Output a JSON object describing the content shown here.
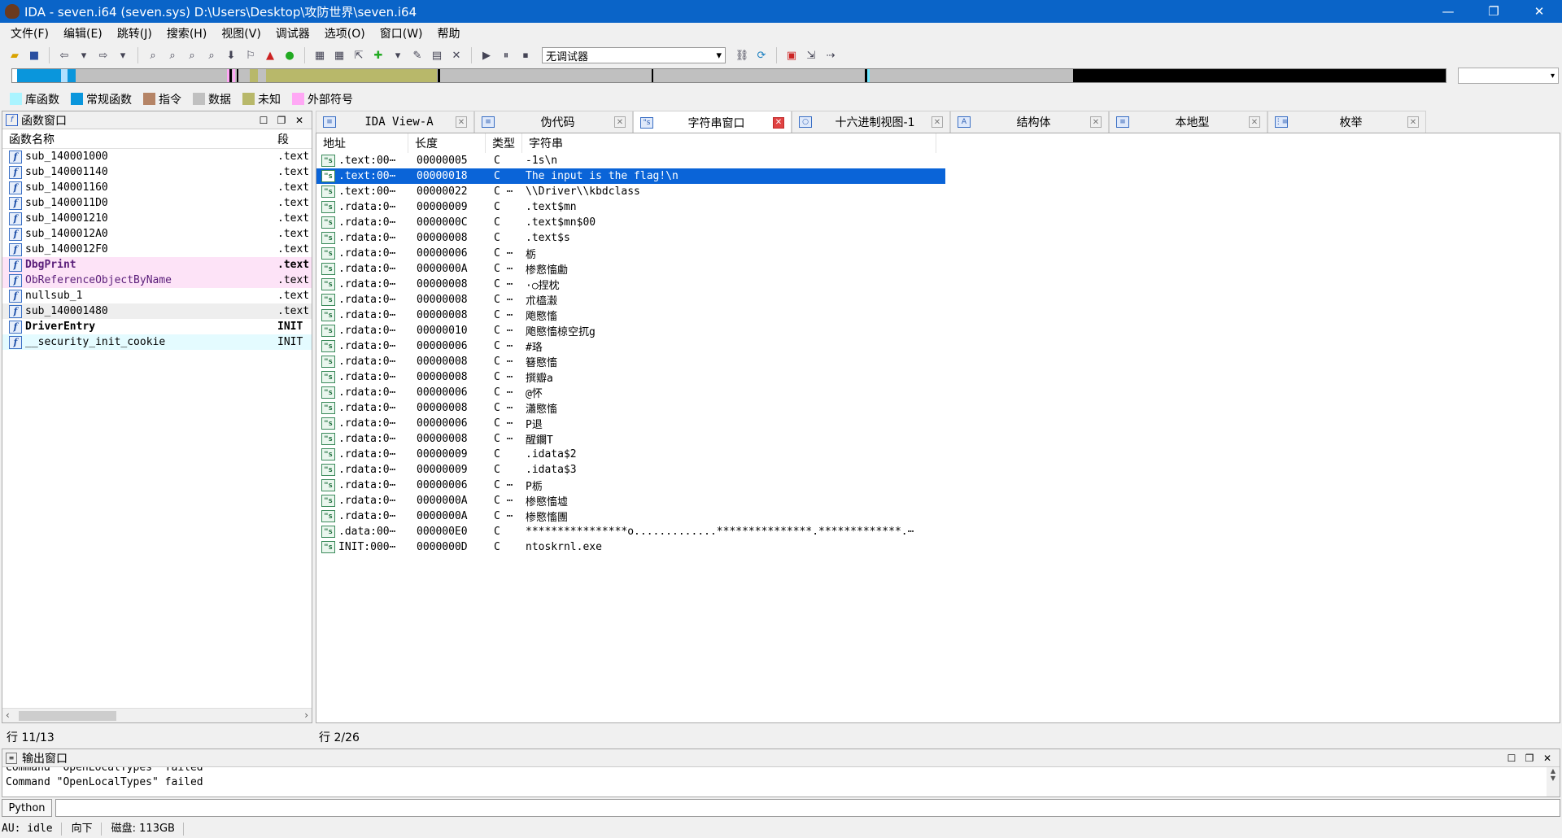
{
  "window": {
    "title": "IDA - seven.i64 (seven.sys) D:\\Users\\Desktop\\攻防世界\\seven.i64",
    "minimize": "—",
    "restore": "❐",
    "close": "✕"
  },
  "menu": [
    "文件(F)",
    "编辑(E)",
    "跳转(J)",
    "搜索(H)",
    "视图(V)",
    "调试器",
    "选项(O)",
    "窗口(W)",
    "帮助"
  ],
  "toolbar": {
    "debugger_select": "无调试器"
  },
  "legend": [
    {
      "label": "库函数",
      "color": "#aaf4ff"
    },
    {
      "label": "常规函数",
      "color": "#0a96dc"
    },
    {
      "label": "指令",
      "color": "#b58466"
    },
    {
      "label": "数据",
      "color": "#c0c0c0"
    },
    {
      "label": "未知",
      "color": "#b8b86a"
    },
    {
      "label": "外部符号",
      "color": "#ffa8f5"
    }
  ],
  "functions": {
    "title": "函数窗口",
    "col_name": "函数名称",
    "col_segment": "段",
    "rows": [
      {
        "name": "sub_140001000",
        "seg": ".text"
      },
      {
        "name": "sub_140001140",
        "seg": ".text"
      },
      {
        "name": "sub_140001160",
        "seg": ".text"
      },
      {
        "name": "sub_1400011D0",
        "seg": ".text"
      },
      {
        "name": "sub_140001210",
        "seg": ".text"
      },
      {
        "name": "sub_1400012A0",
        "seg": ".text"
      },
      {
        "name": "sub_1400012F0",
        "seg": ".text"
      },
      {
        "name": "DbgPrint",
        "seg": ".text"
      },
      {
        "name": "ObReferenceObjectByName",
        "seg": ".text"
      },
      {
        "name": "nullsub_1",
        "seg": ".text"
      },
      {
        "name": "sub_140001480",
        "seg": ".text"
      },
      {
        "name": "DriverEntry",
        "seg": "INIT"
      },
      {
        "name": "__security_init_cookie",
        "seg": "INIT"
      }
    ],
    "status": "行 11/13"
  },
  "tabs": [
    {
      "label": "IDA View-A"
    },
    {
      "label": "伪代码"
    },
    {
      "label": "字符串窗口"
    },
    {
      "label": "十六进制视图-1"
    },
    {
      "label": "结构体"
    },
    {
      "label": "本地型"
    },
    {
      "label": "枚举"
    }
  ],
  "strings": {
    "col_addr": "地址",
    "col_len": "长度",
    "col_type": "类型",
    "col_str": "字符串",
    "rows": [
      {
        "addr": ".text:00⋯",
        "len": "00000005",
        "type": "C",
        "val": "-1s\\n"
      },
      {
        "addr": ".text:00⋯",
        "len": "00000018",
        "type": "C",
        "val": "The input is the flag!\\n"
      },
      {
        "addr": ".text:00⋯",
        "len": "00000022",
        "type": "C ⋯",
        "val": "\\\\Driver\\\\kbdclass"
      },
      {
        "addr": ".rdata:0⋯",
        "len": "00000009",
        "type": "C",
        "val": ".text$mn"
      },
      {
        "addr": ".rdata:0⋯",
        "len": "0000000C",
        "type": "C",
        "val": ".text$mn$00"
      },
      {
        "addr": ".rdata:0⋯",
        "len": "00000008",
        "type": "C",
        "val": ".text$s"
      },
      {
        "addr": ".rdata:0⋯",
        "len": "00000006",
        "type": "C ⋯",
        "val": " 栃"
      },
      {
        "addr": ".rdata:0⋯",
        "len": "0000000A",
        "type": "C ⋯",
        "val": "椮慦慉勴"
      },
      {
        "addr": ".rdata:0⋯",
        "len": "00000008",
        "type": "C ⋯",
        "val": "·○捏枕"
      },
      {
        "addr": ".rdata:0⋯",
        "len": "00000008",
        "type": "C ⋯",
        "val": "朮橀瀫"
      },
      {
        "addr": ".rdata:0⋯",
        "len": "00000008",
        "type": "C ⋯",
        "val": "飑愍慉"
      },
      {
        "addr": ".rdata:0⋯",
        "len": "00000010",
        "type": "C ⋯",
        "val": "飑愍慉椋空扤g"
      },
      {
        "addr": ".rdata:0⋯",
        "len": "00000006",
        "type": "C ⋯",
        "val": "#珞"
      },
      {
        "addr": ".rdata:0⋯",
        "len": "00000008",
        "type": "C ⋯",
        "val": "簮愍慉"
      },
      {
        "addr": ".rdata:0⋯",
        "len": "00000008",
        "type": "C ⋯",
        "val": "撰瓣a"
      },
      {
        "addr": ".rdata:0⋯",
        "len": "00000006",
        "type": "C ⋯",
        "val": "@怀"
      },
      {
        "addr": ".rdata:0⋯",
        "len": "00000008",
        "type": "C ⋯",
        "val": "瀟愍慉"
      },
      {
        "addr": ".rdata:0⋯",
        "len": "00000006",
        "type": "C ⋯",
        "val": "P退"
      },
      {
        "addr": ".rdata:0⋯",
        "len": "00000008",
        "type": "C ⋯",
        "val": "醒鑭T"
      },
      {
        "addr": ".rdata:0⋯",
        "len": "00000009",
        "type": "C",
        "val": ".idata$2"
      },
      {
        "addr": ".rdata:0⋯",
        "len": "00000009",
        "type": "C",
        "val": ".idata$3"
      },
      {
        "addr": ".rdata:0⋯",
        "len": "00000006",
        "type": "C ⋯",
        "val": "P栃"
      },
      {
        "addr": ".rdata:0⋯",
        "len": "0000000A",
        "type": "C ⋯",
        "val": "椮愍慉墟"
      },
      {
        "addr": ".rdata:0⋯",
        "len": "0000000A",
        "type": "C ⋯",
        "val": "椮愍慉團"
      },
      {
        "addr": ".data:00⋯",
        "len": "000000E0",
        "type": "C",
        "val": "****************o.............***************.*************.⋯"
      },
      {
        "addr": "INIT:000⋯",
        "len": "0000000D",
        "type": "C",
        "val": "ntoskrnl.exe"
      }
    ],
    "status": "行 2/26"
  },
  "output": {
    "title": "输出窗口",
    "lines": [
      "Command \"OpenLocalTypes\" failed",
      "Command \"OpenLocalTypes\" failed"
    ]
  },
  "cmd": {
    "lang": "Python"
  },
  "statusbar": {
    "au": "AU:  idle",
    "dir": "向下",
    "disk": "磁盘: 113GB"
  }
}
